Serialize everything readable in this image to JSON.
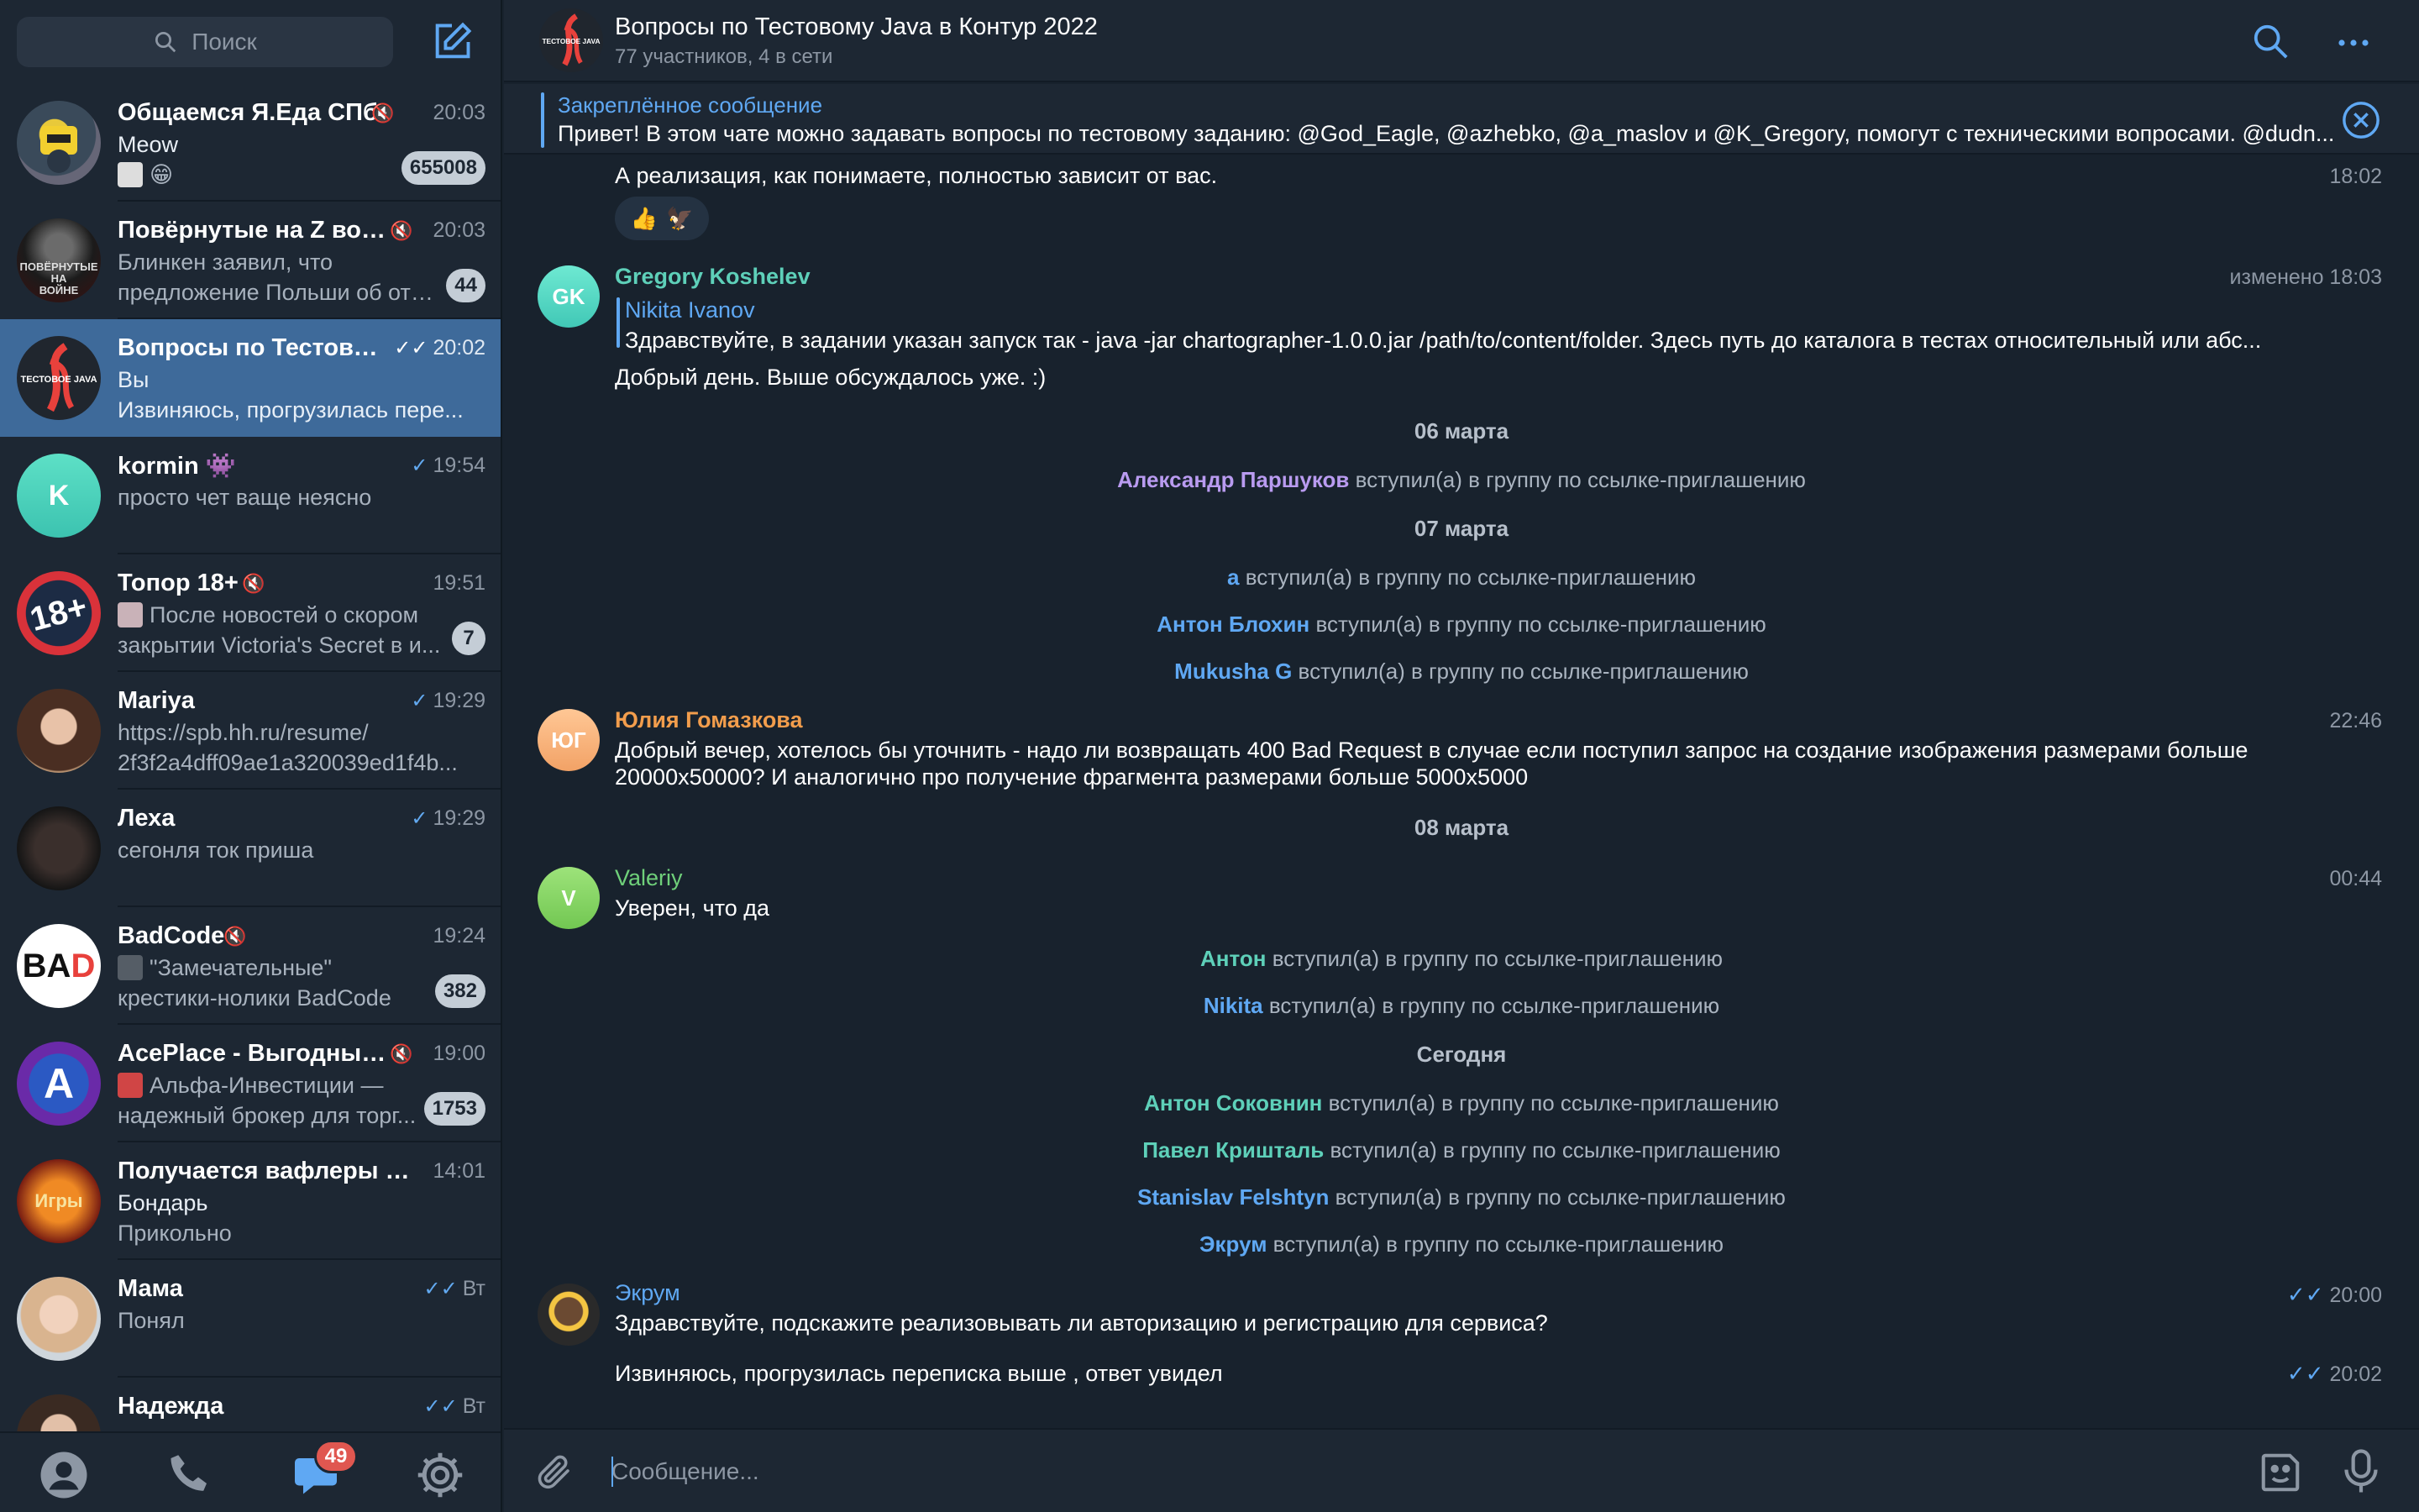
{
  "colors": {
    "accent": "#5fa8f3",
    "active_chat": "#3e6a9a",
    "sidebar_bg": "#1d2733",
    "chat_bg": "#18222d",
    "badge_unread": "#c4cdd6",
    "badge_alert": "#e05750"
  },
  "sidebar": {
    "search_placeholder": "Поиск",
    "chats": [
      {
        "name": "Общаемся Я.Еда СПб",
        "muted": true,
        "time": "20:03",
        "line1": "Meow",
        "line2": "😁",
        "badge": "655008"
      },
      {
        "name": "Повёрнутые на Z вой...",
        "muted": true,
        "time": "20:03",
        "line1": "Блинкен заявил, что",
        "line2": "предложение Польши об отп...",
        "badge": "44"
      },
      {
        "name": "Вопросы по Тестовом...",
        "time": "20:02",
        "ticks": "✓✓",
        "line1": "Вы",
        "line2": "Извиняюсь, прогрузилась пере...",
        "active": true
      },
      {
        "name": "kormin",
        "emoji": "👾",
        "time": "19:54",
        "ticks": "✓",
        "line1": "просто чет ваще неясно"
      },
      {
        "name": "Топор 18+",
        "muted": true,
        "time": "19:51",
        "line1": "После новостей о скором",
        "line2": "закрытии Victoria's Secret в и...",
        "badge": "7"
      },
      {
        "name": "Mariya",
        "time": "19:29",
        "ticks": "✓",
        "line1": "https://spb.hh.ru/resume/",
        "line2": "2f3f2a4dff09ae1a320039ed1f4b..."
      },
      {
        "name": "Леха",
        "time": "19:29",
        "ticks": "✓",
        "line1": "сегонля ток пришa"
      },
      {
        "name": "BadCode",
        "muted": true,
        "time": "19:24",
        "line1": "\"Замечательные\"",
        "line2": "крестики-нолики  BadCode",
        "badge": "382"
      },
      {
        "name": "AcePlace - Выгодный...",
        "muted": true,
        "time": "19:00",
        "line1": "Альфа-Инвестиции —",
        "line2": "надежный брокер для торг...",
        "badge": "1753"
      },
      {
        "name": "Получается вафлеры мо...",
        "time": "14:01",
        "line1": "Бондарь",
        "line2": "Прикольно"
      },
      {
        "name": "Мама",
        "time": "Вт",
        "ticks": "✓✓",
        "line1": "Понял"
      },
      {
        "name": "Надежда",
        "time": "Вт",
        "ticks": "✓✓",
        "line1": ""
      }
    ],
    "tabbar": {
      "chats_badge": "49"
    }
  },
  "chat": {
    "title": "Вопросы по Тестовому Java в Контур 2022",
    "subtitle": "77 участников, 4 в сети",
    "avatar_text": "ТЕСТОВОЕ JAVA",
    "pinned": {
      "title": "Закреплённое сообщение",
      "text": "Привет! В этом чате можно задавать вопросы по тестовому заданию: @God_Eagle, @azhebko, @a_maslov и @K_Gregory, помогут с техническими вопросами. @dudn..."
    },
    "messages": {
      "m1": {
        "text": "А реализация, как понимаете, полностью зависит от вас.",
        "time": "18:02",
        "reactions": [
          "👍",
          "🦅"
        ]
      },
      "m2": {
        "avatar": "GK",
        "sender": "Gregory Koshelev",
        "time": "изменено 18:03",
        "reply_name": "Nikita Ivanov",
        "reply_text": "Здравствуйте, в задании указан запуск так - java -jar chartographer-1.0.0.jar /path/to/content/folder. Здесь путь до каталога в тестах относительный или абс...",
        "text": "Добрый день. Выше обсуждалось уже. :)"
      },
      "d1": "06 марта",
      "s1": {
        "name": "Александр Паршуков",
        "text": "вступил(а) в группу по ссылке-приглашению"
      },
      "d2": "07 марта",
      "s2": {
        "name": "а",
        "text": "вступил(а) в группу по ссылке-приглашению"
      },
      "s3": {
        "name": "Антон Блохин",
        "text": "вступил(а) в группу по ссылке-приглашению"
      },
      "s4": {
        "name": "Mukusha G",
        "text": "вступил(а) в группу по ссылке-приглашению"
      },
      "m3": {
        "avatar": "ЮГ",
        "sender": "Юлия Гомазкова",
        "time": "22:46",
        "line1": "Добрый вечер, хотелось бы уточнить - надо ли возвращать 400 Bad Request в случае если поступил запрос на создание изображения размерами больше",
        "line2": "20000x50000? И аналогично про получение фрагмента размерами больше 5000x5000"
      },
      "d3": "08 марта",
      "m4": {
        "avatar": "V",
        "sender": "Valeriy",
        "time": "00:44",
        "text": "Уверен, что да"
      },
      "s5": {
        "name": "Антон",
        "text": "вступил(а) в группу по ссылке-приглашению"
      },
      "s6": {
        "name": "Nikita",
        "text": "вступил(а) в группу по ссылке-приглашению"
      },
      "d4": "Сегодня",
      "s7": {
        "name": "Антон Соковнин",
        "text": "вступил(а) в группу по ссылке-приглашению"
      },
      "s8": {
        "name": "Павел Кришталь",
        "text": "вступил(а) в группу по ссылке-приглашению"
      },
      "s9": {
        "name": "Stanislav Felshtyn",
        "text": "вступил(а) в группу по ссылке-приглашению"
      },
      "s10": {
        "name": "Экрум",
        "text": "вступил(а) в группу по ссылке-приглашению"
      },
      "m5": {
        "sender": "Экрум",
        "text": "Здравствуйте, подскажите реализовывать ли авторизацию и регистрацию для сервиса?",
        "ticks": "✓✓",
        "time": "20:00"
      },
      "m6": {
        "text": "Извиняюсь, прогрузилась переписка выше , ответ увидел",
        "ticks": "✓✓",
        "time": "20:02"
      }
    },
    "composer": {
      "placeholder": "Сообщение..."
    }
  }
}
